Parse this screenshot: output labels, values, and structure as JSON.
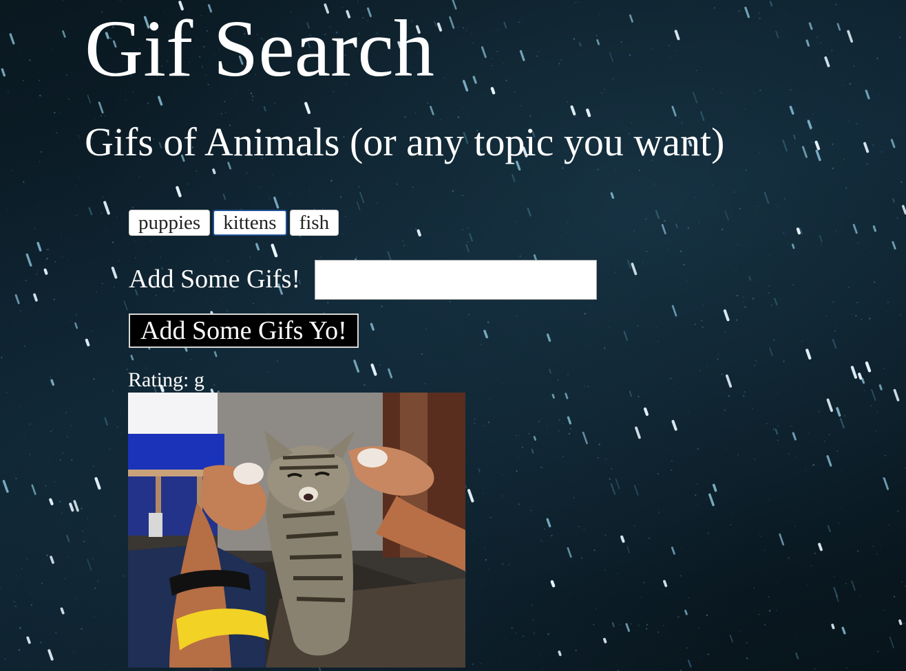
{
  "header": {
    "title": "Gif Search",
    "subtitle": "Gifs of Animals (or any topic you want)"
  },
  "topics": [
    {
      "label": "puppies"
    },
    {
      "label": "kittens"
    },
    {
      "label": "fish"
    }
  ],
  "form": {
    "label": "Add Some Gifs!",
    "input_value": "",
    "input_placeholder": "",
    "submit_label": "Add Some Gifs Yo!"
  },
  "results": [
    {
      "rating": "Rating: g",
      "image": "kitten-gif"
    }
  ],
  "colors": {
    "background": "#0b1a22",
    "text": "#ffffff",
    "topic_button_bg": "#ffffff",
    "focused_border": "#1f4f95",
    "submit_bg": "#000000"
  }
}
